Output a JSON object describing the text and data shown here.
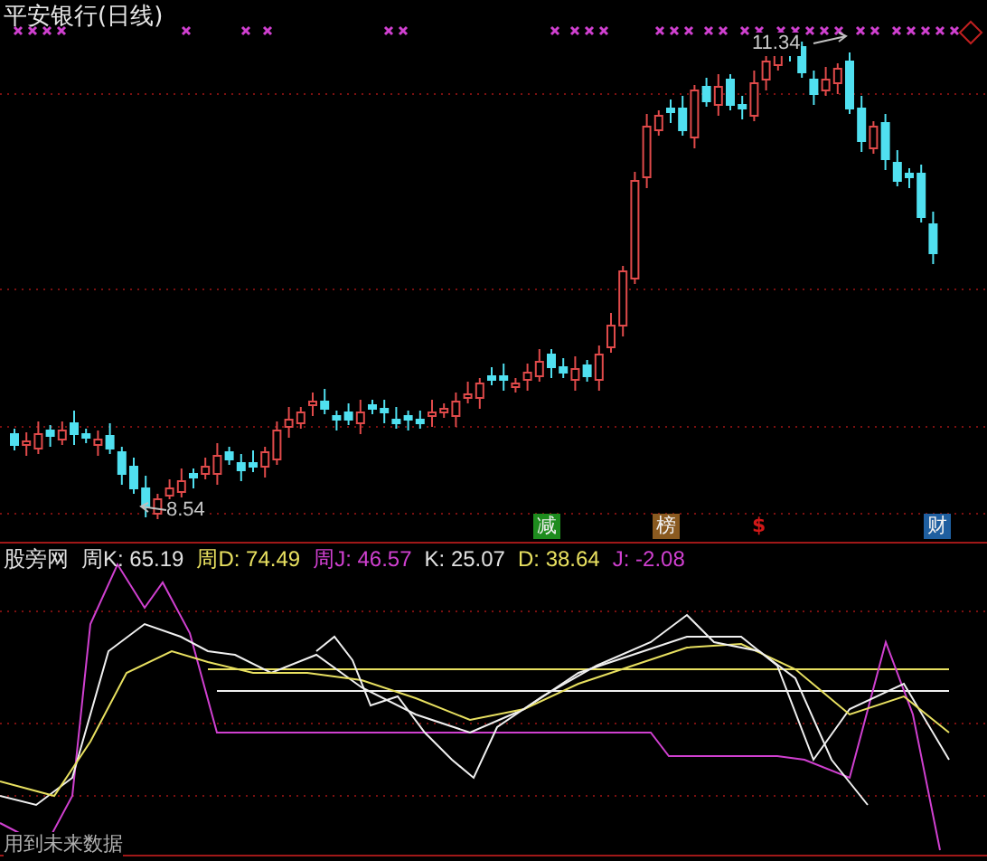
{
  "chart": {
    "title": "平安银行(日线)",
    "high_label": "11.34",
    "low_label": "8.54"
  },
  "signals": [
    {
      "label": "减",
      "color": "#1e8c1e"
    },
    {
      "label": "榜",
      "color": "#8a5a20"
    },
    {
      "label": "$",
      "color": "#d01818"
    },
    {
      "label": "财",
      "color": "#1f5fa0"
    }
  ],
  "indicator": {
    "legend": [
      {
        "text": "股旁网",
        "color": "#e0e0e0"
      },
      {
        "text": "周K: 65.19",
        "color": "#e0e0e0"
      },
      {
        "text": "周D: 74.49",
        "color": "#e8e060"
      },
      {
        "text": "周J: 46.57",
        "color": "#d040d0"
      },
      {
        "text": "K: 25.07",
        "color": "#e0e0e0"
      },
      {
        "text": "D: 38.64",
        "color": "#e8e060"
      },
      {
        "text": "J: -2.08",
        "color": "#d040d0"
      }
    ],
    "note": "用到未来数据"
  }
}
